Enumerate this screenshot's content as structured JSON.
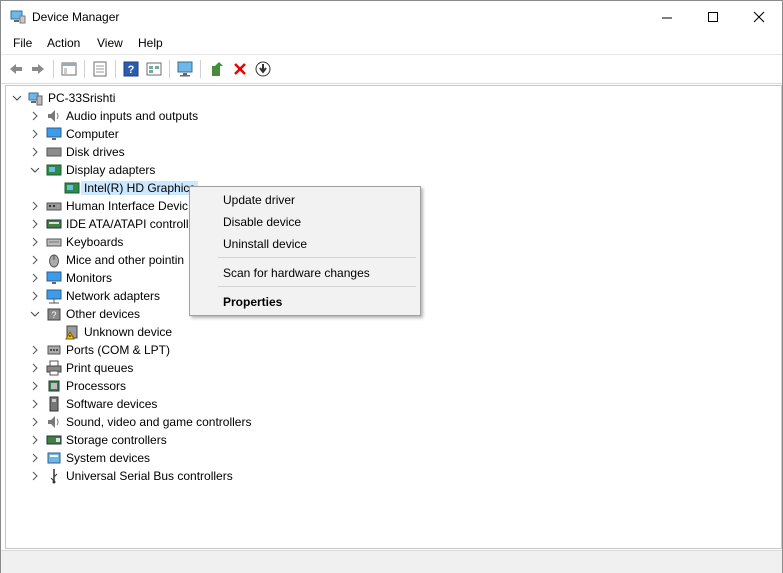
{
  "window": {
    "title": "Device Manager"
  },
  "menu": [
    "File",
    "Action",
    "View",
    "Help"
  ],
  "toolbar": [
    "back-icon",
    "forward-icon",
    "show-hide-tree-icon",
    "properties-icon",
    "help-icon",
    "view-icon",
    "monitor-scan-icon",
    "update-driver-icon",
    "uninstall-icon",
    "download-icon"
  ],
  "tree": {
    "root": "PC-33Srishti",
    "categories": [
      "Audio inputs and outputs",
      "Computer",
      "Disk drives",
      "Display adapters",
      "Intel(R) HD Graphics",
      "Human Interface Devic",
      "IDE ATA/ATAPI controll",
      "Keyboards",
      "Mice and other pointin",
      "Monitors",
      "Network adapters",
      "Other devices",
      "Unknown device",
      "Ports (COM & LPT)",
      "Print queues",
      "Processors",
      "Software devices",
      "Sound, video and game controllers",
      "Storage controllers",
      "System devices",
      "Universal Serial Bus controllers"
    ]
  },
  "context_menu": {
    "update": "Update driver",
    "disable": "Disable device",
    "uninstall": "Uninstall device",
    "scan": "Scan for hardware changes",
    "properties": "Properties"
  },
  "colors": {
    "selection": "#cce8ff",
    "accent": "#0078d7",
    "close_red": "#e81123"
  }
}
